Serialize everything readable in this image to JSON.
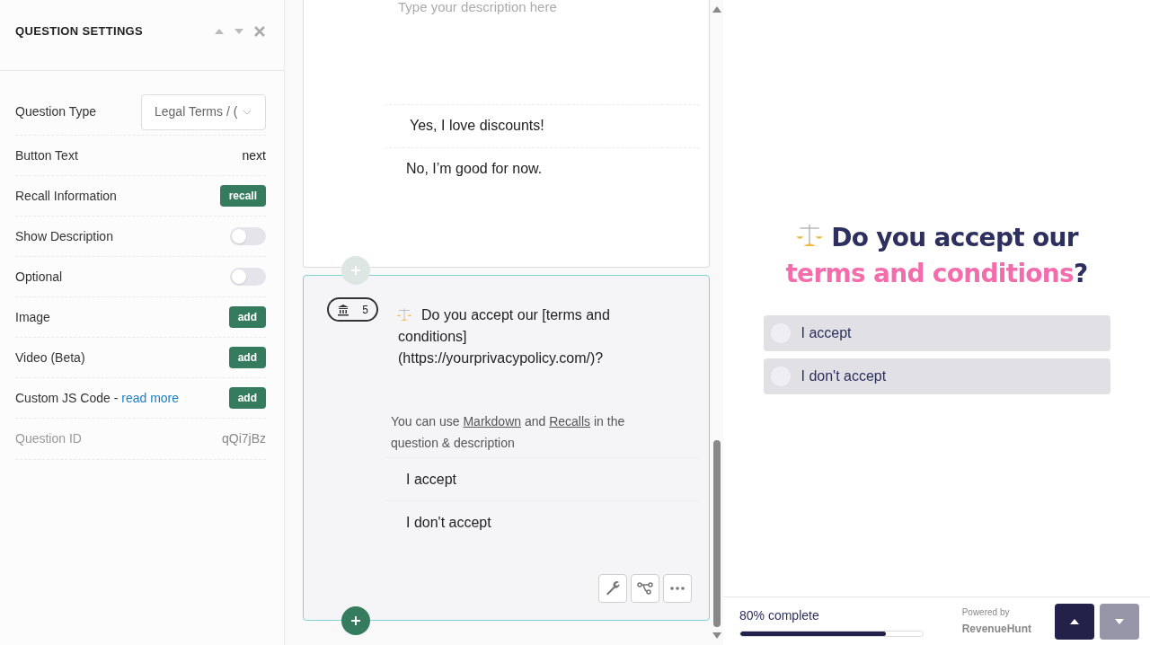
{
  "settings_panel": {
    "title": "QUESTION SETTINGS",
    "rows": [
      {
        "kind": "select",
        "label": "Question Type",
        "value": "Legal Terms / ("
      },
      {
        "kind": "text",
        "label": "Button Text",
        "value": "next"
      },
      {
        "kind": "button",
        "label": "Recall Information",
        "button": "recall"
      },
      {
        "kind": "toggle",
        "label": "Show Description",
        "on": false
      },
      {
        "kind": "toggle",
        "label": "Optional",
        "on": false
      },
      {
        "kind": "button",
        "label": "Image",
        "button": "add"
      },
      {
        "kind": "button",
        "label": "Video (Beta)",
        "button": "add"
      },
      {
        "kind": "button",
        "label": "Custom JS Code - ",
        "link": "read more",
        "button": "add"
      },
      {
        "kind": "readonly",
        "label": "Question ID",
        "value": "qQi7jBz"
      }
    ]
  },
  "editor": {
    "previous_card": {
      "description_placeholder": "Type your description here",
      "answers": [
        "Yes, I love discounts!",
        "No, I’m good for now."
      ]
    },
    "current_card": {
      "number": "5",
      "question": "Do you accept our [terms and conditions](https://yourprivacypolicy.com/)?",
      "hint": [
        {
          "kind": "text",
          "text": "You can use "
        },
        {
          "kind": "link",
          "text": "Markdown"
        },
        {
          "kind": "text",
          "text": " and "
        },
        {
          "kind": "link",
          "text": "Recalls"
        },
        {
          "kind": "text",
          "text": " in the question & description"
        }
      ],
      "answers": [
        "I accept",
        "I don't accept"
      ]
    }
  },
  "preview": {
    "title": [
      {
        "kind": "plain",
        "text": "Do you accept our "
      },
      {
        "kind": "highlight",
        "text": "terms and conditions"
      },
      {
        "kind": "plain",
        "text": "?"
      }
    ],
    "options": [
      {
        "label": "I accept",
        "selected": false
      },
      {
        "label": "I don't accept",
        "selected": false
      }
    ],
    "progress": {
      "label": "80% complete",
      "level": 0.8
    },
    "powered_by": "Powered by",
    "brand": "RevenueHunt",
    "nav": [
      {
        "kind": "up",
        "disabled": false
      },
      {
        "kind": "down",
        "disabled": true
      }
    ]
  }
}
